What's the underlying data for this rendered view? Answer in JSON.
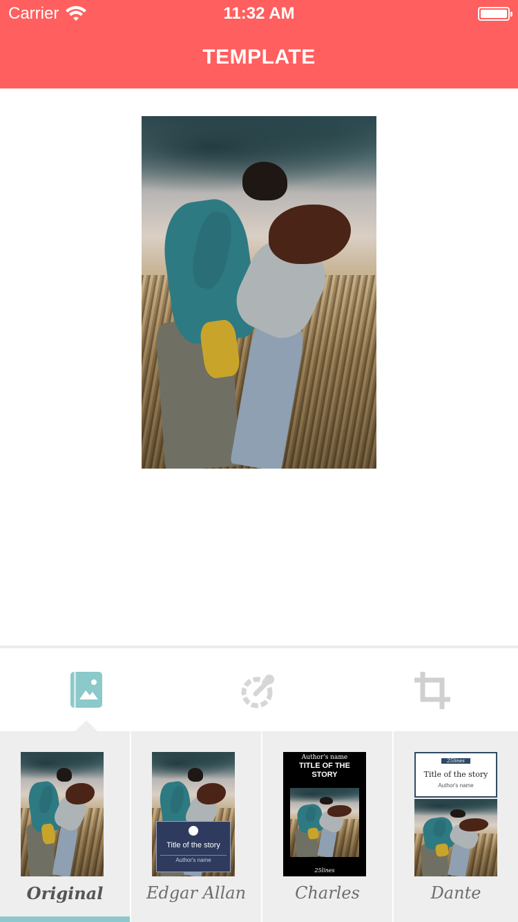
{
  "status_bar": {
    "carrier": "Carrier",
    "time": "11:32 AM"
  },
  "nav": {
    "title": "TEMPLATE",
    "background_color": "#ff5f5f"
  },
  "tabs": [
    {
      "name": "template-tab",
      "icon": "book-image-icon",
      "active": true,
      "color": "#8cc9cb"
    },
    {
      "name": "color-tab",
      "icon": "color-picker-icon",
      "active": false,
      "color": "#d0d0d0"
    },
    {
      "name": "crop-tab",
      "icon": "crop-icon",
      "active": false,
      "color": "#d0d0d0"
    }
  ],
  "templates": [
    {
      "label": "Original",
      "active": true
    },
    {
      "label": "Edgar Allan",
      "active": false,
      "cover_title": "Title of the story",
      "cover_author": "Author's name"
    },
    {
      "label": "Charles",
      "active": false,
      "cover_author": "Author's name",
      "cover_title": "TITLE OF THE STORY",
      "logo": "25lines"
    },
    {
      "label": "Dante",
      "active": false,
      "logo": "25lines",
      "cover_title": "Title of the story",
      "cover_author": "Author's name"
    }
  ],
  "accent_color": "#8cc9cb"
}
